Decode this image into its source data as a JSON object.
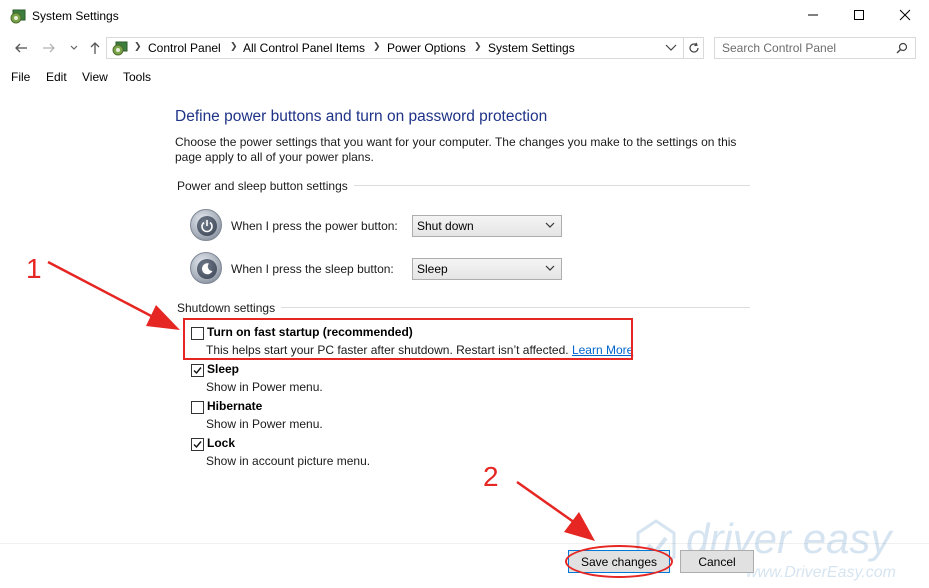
{
  "window": {
    "title": "System Settings",
    "minimize_icon": "minimize-icon",
    "maximize_icon": "maximize-icon",
    "close_icon": "close-icon"
  },
  "address_bar": {
    "breadcrumbs": [
      "Control Panel",
      "All Control Panel Items",
      "Power Options",
      "System Settings"
    ],
    "search_placeholder": "Search Control Panel"
  },
  "menu": [
    "File",
    "Edit",
    "View",
    "Tools"
  ],
  "content": {
    "heading": "Define power buttons and turn on password protection",
    "description": "Choose the power settings that you want for your computer. The changes you make to the settings on this page apply to all of your power plans.",
    "power_section": {
      "label": "Power and sleep button settings",
      "rows": [
        {
          "label": "When I press the power button:",
          "value": "Shut down"
        },
        {
          "label": "When I press the sleep button:",
          "value": "Sleep"
        }
      ]
    },
    "shutdown_section": {
      "label": "Shutdown settings",
      "items": [
        {
          "label": "Turn on fast startup (recommended)",
          "sub": "This helps start your PC faster after shutdown. Restart isn’t affected.",
          "link": "Learn More",
          "checked": false
        },
        {
          "label": "Sleep",
          "sub": "Show in Power menu.",
          "checked": true
        },
        {
          "label": "Hibernate",
          "sub": "Show in Power menu.",
          "checked": false
        },
        {
          "label": "Lock",
          "sub": "Show in account picture menu.",
          "checked": true
        }
      ]
    }
  },
  "buttons": {
    "save": "Save changes",
    "cancel": "Cancel"
  },
  "annotations": {
    "step1": "1",
    "step2": "2",
    "color": "#e52622"
  },
  "watermark": {
    "brand": "driver easy",
    "url": "www.DriverEasy.com"
  }
}
